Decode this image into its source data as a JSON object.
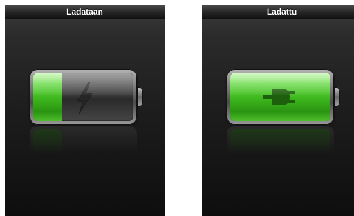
{
  "screens": [
    {
      "status_title": "Ladataan",
      "charge_level": 0.28,
      "symbol_icon": "lightning-bolt-icon"
    },
    {
      "status_title": "Ladattu",
      "charge_level": 1.0,
      "symbol_icon": "power-plug-icon"
    }
  ],
  "colors": {
    "charge_green": "#3cb51c",
    "symbol_dark_green": "#1d5f0c",
    "bolt_gray": "#262626"
  }
}
